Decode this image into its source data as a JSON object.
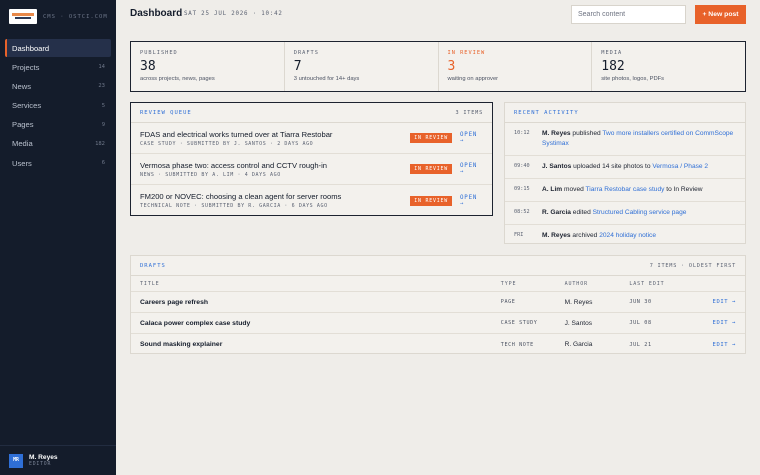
{
  "brand": {
    "tagline": "CMS · OSTCI.COM"
  },
  "nav": [
    {
      "label": "Dashboard",
      "count": ""
    },
    {
      "label": "Projects",
      "count": "14"
    },
    {
      "label": "News",
      "count": "23"
    },
    {
      "label": "Services",
      "count": "5"
    },
    {
      "label": "Pages",
      "count": "9"
    },
    {
      "label": "Media",
      "count": "182"
    },
    {
      "label": "Users",
      "count": "6"
    }
  ],
  "user": {
    "initials": "MR",
    "name": "M. Reyes",
    "role": "EDITOR"
  },
  "header": {
    "title": "Dashboard",
    "date": "SAT 25 JUL 2026 · 10:42",
    "search_placeholder": "Search content",
    "new_post_label": "+ New post"
  },
  "stats": [
    {
      "label": "PUBLISHED",
      "value": "38",
      "desc": "across projects, news, pages"
    },
    {
      "label": "DRAFTS",
      "value": "7",
      "desc": "3 untouched for 14+ days"
    },
    {
      "label": "IN REVIEW",
      "value": "3",
      "desc": "waiting on approver"
    },
    {
      "label": "MEDIA",
      "value": "182",
      "desc": "site photos, logos, PDFs"
    }
  ],
  "review_queue": {
    "title": "REVIEW QUEUE",
    "meta": "3 ITEMS",
    "items": [
      {
        "title": "FDAS and electrical works turned over at Tiarra Restobar",
        "sub": "CASE STUDY · SUBMITTED BY J. SANTOS · 2 DAYS AGO",
        "status": "IN REVIEW",
        "action": "OPEN →"
      },
      {
        "title": "Vermosa phase two: access control and CCTV rough-in",
        "sub": "NEWS · SUBMITTED BY A. LIM · 4 DAYS AGO",
        "status": "IN REVIEW",
        "action": "OPEN →"
      },
      {
        "title": "FM200 or NOVEC: choosing a clean agent for server rooms",
        "sub": "TECHNICAL NOTE · SUBMITTED BY R. GARCIA · 6 DAYS AGO",
        "status": "IN REVIEW",
        "action": "OPEN →"
      }
    ]
  },
  "activity": {
    "title": "RECENT ACTIVITY",
    "items": [
      {
        "time": "10:12",
        "actor": "M. Reyes",
        "verb": " published ",
        "target": "Two more installers certified on CommScope Systimax",
        "tail": ""
      },
      {
        "time": "09:40",
        "actor": "J. Santos",
        "verb": " uploaded 14 site photos to ",
        "target": "Vermosa / Phase 2",
        "tail": ""
      },
      {
        "time": "09:15",
        "actor": "A. Lim",
        "verb": " moved ",
        "target": "Tiarra Restobar case study",
        "tail": " to In Review"
      },
      {
        "time": "08:52",
        "actor": "R. Garcia",
        "verb": " edited ",
        "target": "Structured Cabling service page",
        "tail": ""
      },
      {
        "time": "FRI",
        "actor": "M. Reyes",
        "verb": " archived ",
        "target": "2024 holiday notice",
        "tail": ""
      }
    ]
  },
  "drafts": {
    "title": "DRAFTS",
    "meta": "7 ITEMS · OLDEST FIRST",
    "columns": {
      "title": "TITLE",
      "type": "TYPE",
      "author": "AUTHOR",
      "edited": "LAST EDIT"
    },
    "rows": [
      {
        "title": "Careers page refresh",
        "type": "PAGE",
        "author": "M. Reyes",
        "date": "JUN 30",
        "action": "EDIT →"
      },
      {
        "title": "Calaca power complex case study",
        "type": "CASE STUDY",
        "author": "J. Santos",
        "date": "JUL 08",
        "action": "EDIT →"
      },
      {
        "title": "Sound masking explainer",
        "type": "TECH NOTE",
        "author": "R. Garcia",
        "date": "JUL 21",
        "action": "EDIT →"
      }
    ]
  },
  "colors": {
    "accent": "#e8622a",
    "link": "#2f6fd6",
    "sidebar": "#141c2b",
    "background": "#efede9"
  }
}
